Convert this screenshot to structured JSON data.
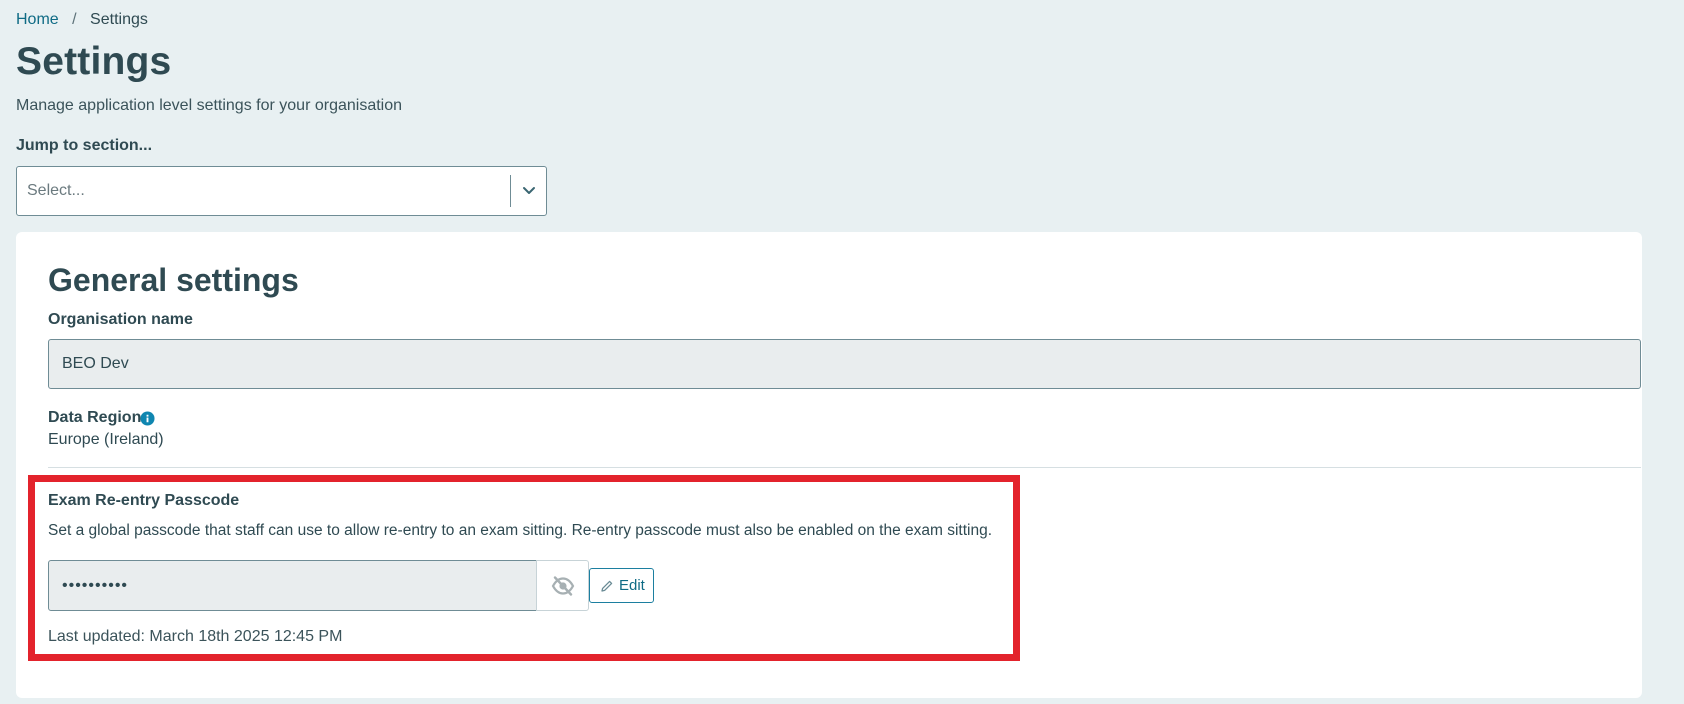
{
  "breadcrumb": {
    "home": "Home",
    "separator": "/",
    "current": "Settings"
  },
  "header": {
    "title": "Settings",
    "subtitle": "Manage application level settings for your organisation"
  },
  "jump": {
    "label": "Jump to section...",
    "placeholder": "Select..."
  },
  "general": {
    "title": "General settings",
    "org_label": "Organisation name",
    "org_value": "BEO Dev",
    "region_label": "Data Region",
    "region_value": "Europe (Ireland)"
  },
  "passcode": {
    "title": "Exam Re-entry Passcode",
    "description": "Set a global passcode that staff can use to allow re-entry to an exam sitting. Re-entry passcode must also be enabled on the exam sitting.",
    "masked_value": "••••••••••",
    "edit_label": "Edit",
    "last_updated": "Last updated: March 18th 2025 12:45 PM"
  },
  "colors": {
    "accent": "#0f6b85",
    "highlight": "#e3232c",
    "background": "#e8f0f2"
  },
  "icons": {
    "select": "chevron-down-icon",
    "info": "info-icon",
    "eye": "eye-off-icon",
    "edit": "pencil-icon"
  }
}
